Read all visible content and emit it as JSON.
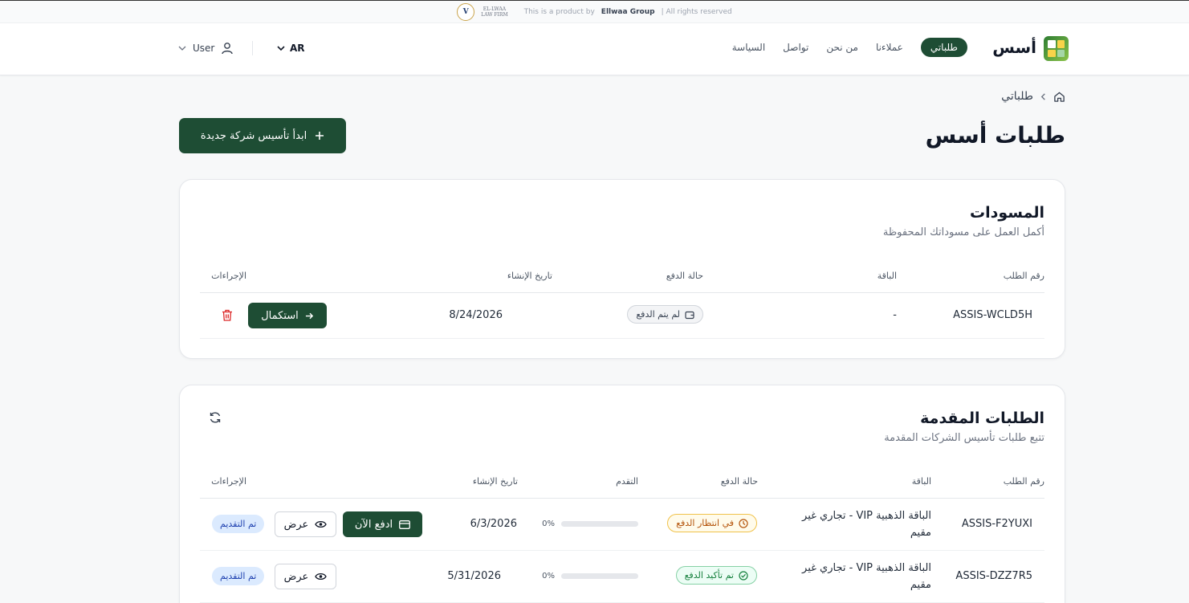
{
  "topbar": {
    "seal_letter": "V",
    "firm_line1": "EL-LWAA",
    "firm_line2": "LAW FIRM",
    "product_by": "This is a product by",
    "company": "Ellwaa Group",
    "rights": "| All rights reserved"
  },
  "header": {
    "brand": "أسس",
    "nav": [
      "طلباتي",
      "عملاءنا",
      "من نحن",
      "تواصل",
      "السياسة"
    ],
    "active_nav": "طلباتي",
    "lang": "AR",
    "user": "User"
  },
  "breadcrumb": {
    "current": "طلباتي"
  },
  "page": {
    "title": "طلبات أسس",
    "new_button": "ابدأ تأسيس شركة جديدة"
  },
  "drafts": {
    "title": "المسودات",
    "subtitle": "أكمل العمل على مسوداتك المحفوظة",
    "columns": [
      "رقم الطلب",
      "الباقة",
      "حالة الدفع",
      "تاريخ الإنشاء",
      "الإجراءات"
    ],
    "rows": [
      {
        "id": "ASSIS-WCLD5H",
        "package": "-",
        "payment_status": "لم يتم الدفع",
        "created": "8/24/2026",
        "action": "استكمال"
      }
    ]
  },
  "submitted": {
    "title": "الطلبات المقدمة",
    "subtitle": "تتبع طلبات تأسيس الشركات المقدمة",
    "columns": [
      "رقم الطلب",
      "الباقة",
      "حالة الدفع",
      "التقدم",
      "تاريخ الإنشاء",
      "الإجراءات"
    ],
    "rows": [
      {
        "id": "ASSIS-F2YUXI",
        "package": "الباقة الذهبية VIP - تجاري غير مقيم",
        "payment_status": "في انتظار الدفع",
        "progress": 0,
        "progress_label": "0%",
        "created": "6/3/2026",
        "pay_button": "ادفع الآن",
        "view_button": "عرض",
        "status": "تم التقديم"
      },
      {
        "id": "ASSIS-DZZ7R5",
        "package": "الباقة الذهبية VIP - تجاري غير مقيم",
        "payment_status": "تم تأكيد الدفع",
        "progress": 0,
        "progress_label": "0%",
        "created": "5/31/2026",
        "view_button": "عرض",
        "status": "تم التقديم"
      }
    ]
  },
  "colors": {
    "primary": "#1e4d34",
    "amber": "#b45309",
    "green": "#15803d",
    "blue_badge": "#dbeafe"
  }
}
